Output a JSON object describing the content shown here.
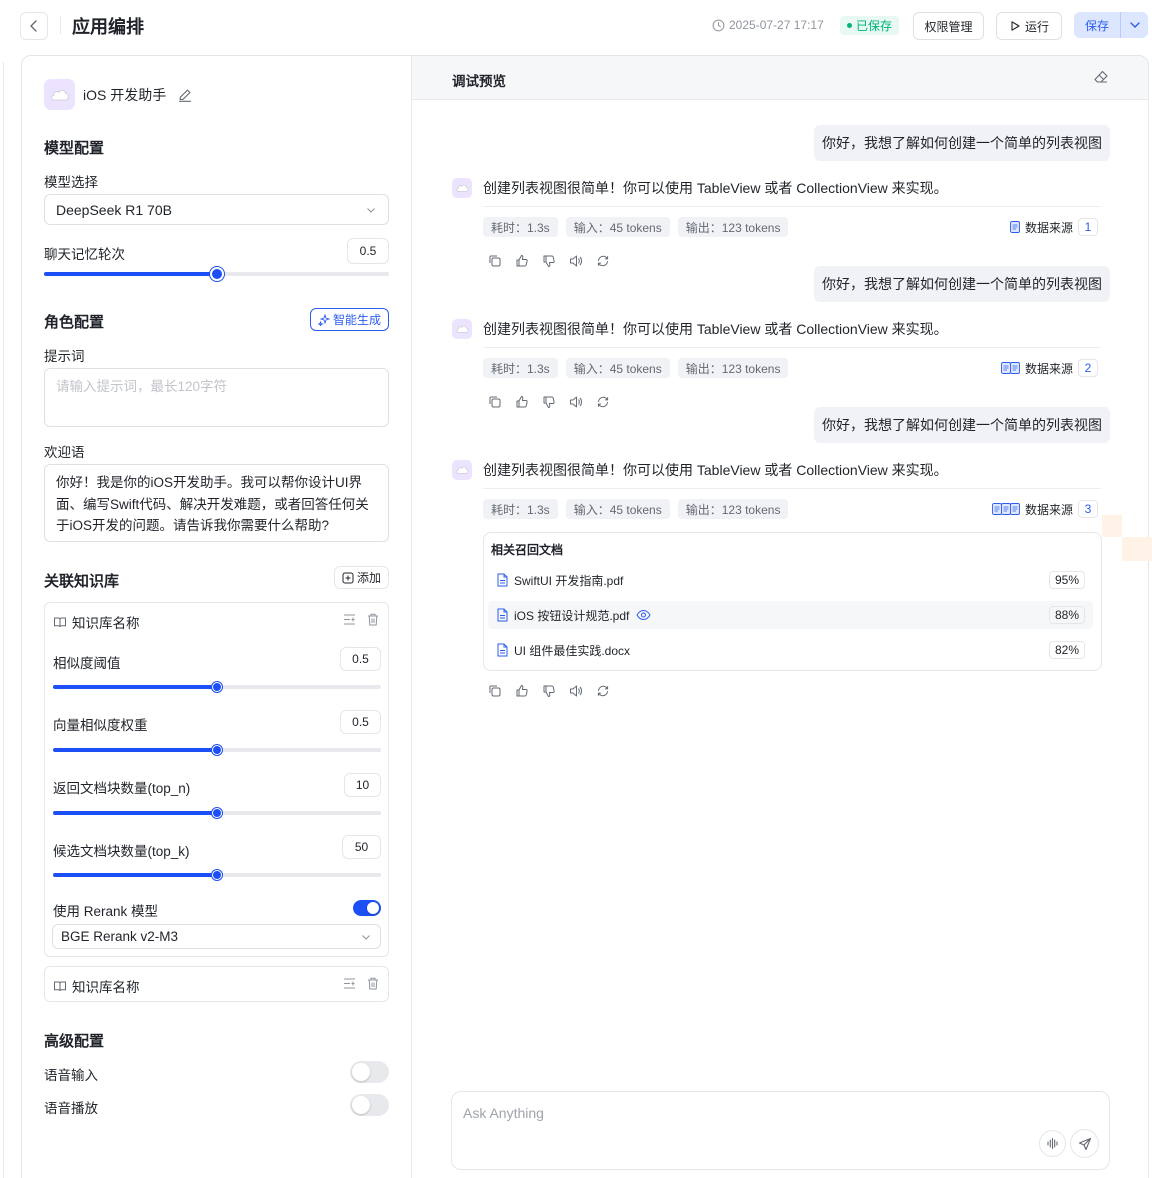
{
  "header": {
    "title": "应用编排",
    "saved_time": "2025-07-27 17:17",
    "saved_status": "已保存",
    "permission_label": "权限管理",
    "run_label": "运行",
    "save_label": "保存"
  },
  "app": {
    "name": "iOS 开发助手"
  },
  "model_config": {
    "title": "模型配置",
    "model_select_label": "模型选择",
    "model_value": "DeepSeek R1 70B",
    "memory_label": "聊天记忆轮次",
    "memory_value": "0.5",
    "memory_fraction": 0.5
  },
  "role_config": {
    "title": "角色配置",
    "smart_generate_label": "智能生成",
    "prompt_label": "提示词",
    "prompt_placeholder": "请输入提示词，最长120字符",
    "welcome_label": "欢迎语",
    "welcome_text": "你好！我是你的iOS开发助手。我可以帮你设计UI界面、编写Swift代码、解决开发难题，或者回答任何关于iOS开发的问题。请告诉我你需要什么帮助?"
  },
  "knowledge": {
    "title": "关联知识库",
    "add_label": "添加",
    "kb1": {
      "name": "知识库名称",
      "params": [
        {
          "label": "相似度阈值",
          "value": "0.5",
          "fraction": 0.5
        },
        {
          "label": "向量相似度权重",
          "value": "0.5",
          "fraction": 0.5
        },
        {
          "label": "返回文档块数量(top_n)",
          "value": "10",
          "fraction": 0.5
        },
        {
          "label": "候选文档块数量(top_k)",
          "value": "50",
          "fraction": 0.5
        }
      ],
      "rerank_label": "使用 Rerank 模型",
      "rerank_enabled": true,
      "rerank_model": "BGE Rerank v2-M3"
    },
    "kb2": {
      "name": "知识库名称"
    }
  },
  "advanced": {
    "title": "高级配置",
    "voice_input_label": "语音输入",
    "voice_input_enabled": false,
    "voice_play_label": "语音播放",
    "voice_play_enabled": false
  },
  "preview": {
    "title": "调试预览",
    "messages": [
      {
        "user": "你好，我想了解如何创建一个简单的列表视图",
        "bot": "创建列表视图很简单！你可以使用 TableView 或者 CollectionView 来实现。",
        "time": "耗时：1.3s",
        "input": "输入：45 tokens",
        "output": "输出：123 tokens",
        "source_label": "数据来源",
        "source_count": "1"
      },
      {
        "user": "你好，我想了解如何创建一个简单的列表视图",
        "bot": "创建列表视图很简单！你可以使用 TableView 或者 CollectionView 来实现。",
        "time": "耗时：1.3s",
        "input": "输入：45 tokens",
        "output": "输出：123 tokens",
        "source_label": "数据来源",
        "source_count": "2"
      },
      {
        "user": "你好，我想了解如何创建一个简单的列表视图",
        "bot": "创建列表视图很简单！你可以使用 TableView 或者 CollectionView 来实现。",
        "time": "耗时：1.3s",
        "input": "输入：45 tokens",
        "output": "输出：123 tokens",
        "source_label": "数据来源",
        "source_count": "3"
      }
    ],
    "docs": {
      "title": "相关召回文档",
      "items": [
        {
          "name": "SwiftUI 开发指南.pdf",
          "score": "95%"
        },
        {
          "name": "iOS 按钮设计规范.pdf",
          "score": "88%"
        },
        {
          "name": "UI 组件最佳实践.docx",
          "score": "82%"
        }
      ]
    },
    "input_placeholder": "Ask Anything"
  },
  "colors": {
    "accent": "#1c4ff5",
    "saved_green": "#00b47a",
    "save_bg": "#dde6ff"
  },
  "icons": [
    "back-icon",
    "clock-icon",
    "play-icon",
    "chevron-down-icon",
    "edit-icon",
    "sparkle-icon",
    "plus-square-icon",
    "book-icon",
    "settings-icon",
    "trash-icon",
    "eraser-icon",
    "file-icon",
    "eye-icon",
    "copy-icon",
    "thumb-up-icon",
    "thumb-down-icon",
    "speaker-icon",
    "refresh-icon",
    "voice-icon",
    "send-icon"
  ]
}
